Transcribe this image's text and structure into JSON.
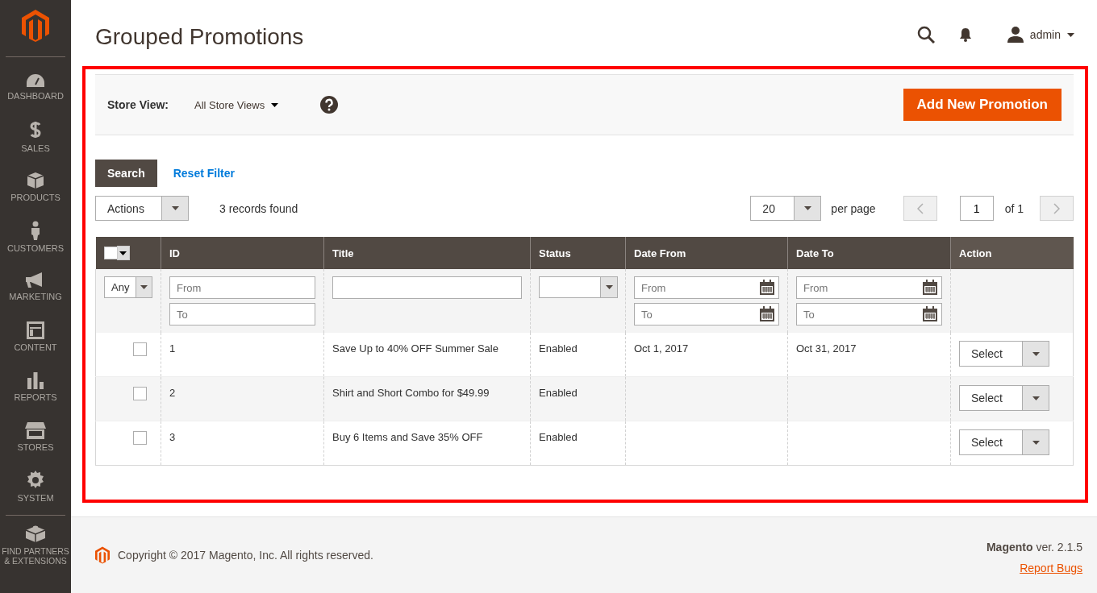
{
  "sidebar": {
    "items": [
      {
        "kind": "dashboard",
        "label": "DASHBOARD"
      },
      {
        "kind": "sales",
        "label": "SALES"
      },
      {
        "kind": "products",
        "label": "PRODUCTS"
      },
      {
        "kind": "customers",
        "label": "CUSTOMERS"
      },
      {
        "kind": "marketing",
        "label": "MARKETING"
      },
      {
        "kind": "content",
        "label": "CONTENT"
      },
      {
        "kind": "reports",
        "label": "REPORTS"
      },
      {
        "kind": "stores",
        "label": "STORES"
      },
      {
        "kind": "system",
        "label": "SYSTEM"
      },
      {
        "kind": "partners",
        "label": "FIND PARTNERS & EXTENSIONS"
      }
    ]
  },
  "header": {
    "title": "Grouped Promotions",
    "user": "admin"
  },
  "store_view": {
    "label": "Store View:",
    "value": "All Store Views",
    "add_button": "Add New Promotion"
  },
  "toolbar": {
    "search": "Search",
    "reset": "Reset Filter",
    "actions": "Actions",
    "records": "3 records found",
    "per_page_value": "20",
    "per_page_label": "per page",
    "page": "1",
    "of_pages": "of 1"
  },
  "table": {
    "columns": [
      "ID",
      "Title",
      "Status",
      "Date From",
      "Date To",
      "Action"
    ],
    "mass_select": {
      "checked": false
    },
    "filters": {
      "mass": "Any",
      "id_from": {
        "placeholder": "From"
      },
      "id_to": {
        "placeholder": "To"
      },
      "date_from_from": {
        "placeholder": "From"
      },
      "date_from_to": {
        "placeholder": "To"
      },
      "date_to_from": {
        "placeholder": "From"
      },
      "date_to_to": {
        "placeholder": "To"
      }
    },
    "rows": [
      {
        "checked": false,
        "id": "1",
        "title": "Save Up to 40% OFF Summer Sale",
        "status": "Enabled",
        "date_from": "Oct 1, 2017",
        "date_to": "Oct 31, 2017",
        "action": "Select"
      },
      {
        "checked": false,
        "id": "2",
        "title": "Shirt and Short Combo for $49.99",
        "status": "Enabled",
        "action": "Select"
      },
      {
        "checked": false,
        "id": "3",
        "title": "Buy 6 Items and Save 35% OFF",
        "status": "Enabled",
        "action": "Select"
      }
    ]
  },
  "footer": {
    "copyright": "Copyright © 2017 Magento, Inc. All rights reserved.",
    "brand": "Magento",
    "version": "ver. 2.1.5",
    "report": "Report Bugs"
  }
}
